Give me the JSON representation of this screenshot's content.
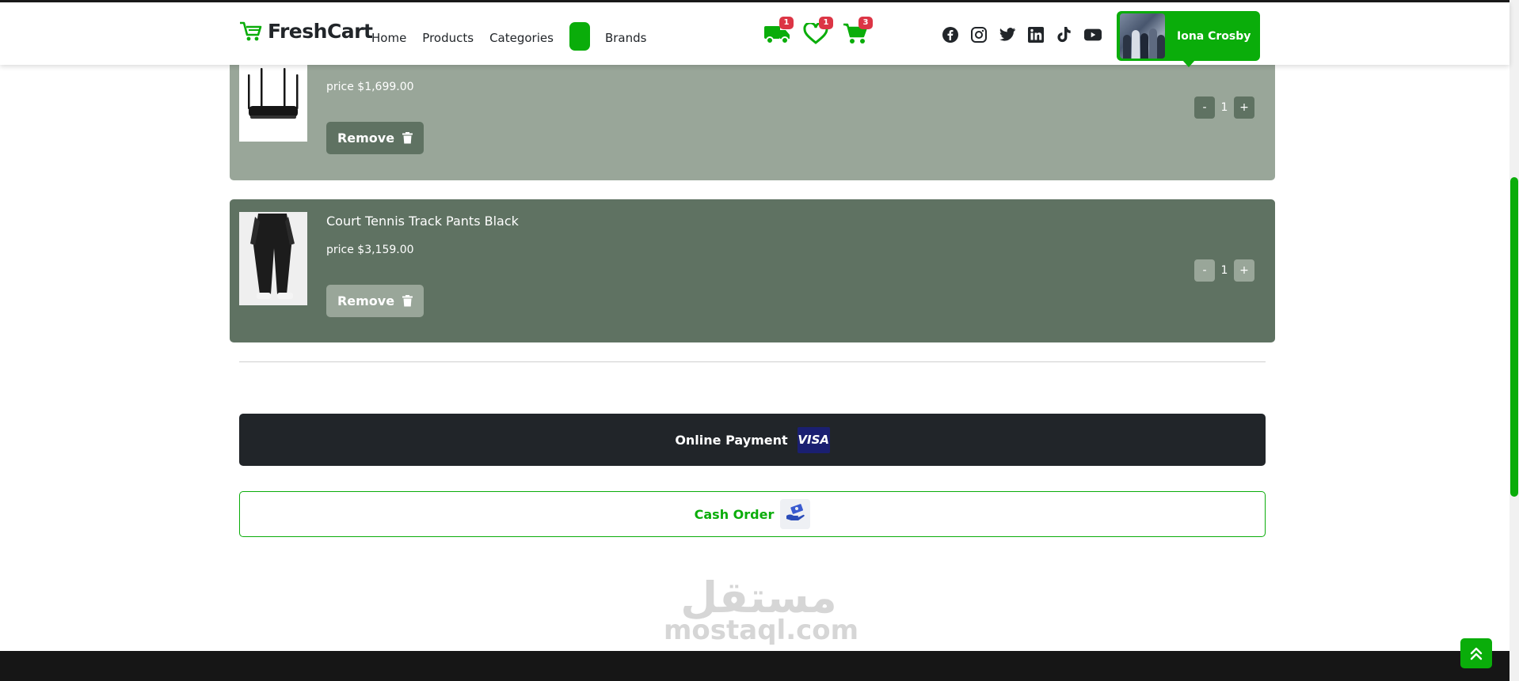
{
  "brand": {
    "name": "FreshCart"
  },
  "nav": {
    "links": [
      "Home",
      "Products",
      "Categories",
      "Brands"
    ]
  },
  "actions": {
    "orders_count": "1",
    "wishlist_count": "1",
    "cart_count": "3"
  },
  "socials": [
    "facebook-icon",
    "instagram-icon",
    "twitter-icon",
    "linkedin-icon",
    "tiktok-icon",
    "youtube-icon"
  ],
  "user": {
    "name": "Iona Crosby"
  },
  "cart": {
    "items": [
      {
        "title": "",
        "price": "price $1,699.00",
        "quantity": "1",
        "remove_label": "Remove"
      },
      {
        "title": "Court Tennis Track Pants Black",
        "price": "price $3,159.00",
        "quantity": "1",
        "remove_label": "Remove"
      }
    ],
    "minus_label": "-",
    "plus_label": "+"
  },
  "payment": {
    "online_label": "Online Payment",
    "visa_text": "VISA",
    "cash_label": "Cash Order"
  },
  "watermark": {
    "arabic": "مستقل",
    "latin": "mostaql.com"
  },
  "colors": {
    "accent": "#0aad0a",
    "dark": "#212529",
    "badge": "#dc3545",
    "item_light": "#99a699",
    "item_dark": "#5f7262"
  }
}
